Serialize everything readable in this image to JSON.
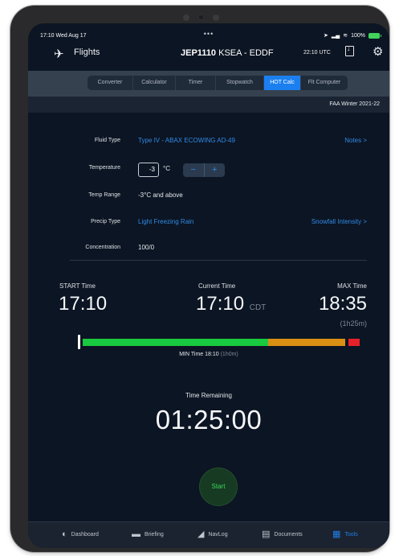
{
  "status_bar": {
    "time": "17:10",
    "date": "Wed Aug 17",
    "dots": "•••",
    "battery": "100%"
  },
  "navbar": {
    "flights_label": "Flights",
    "flight_id": "JEP1110",
    "route": "KSEA - EDDF",
    "utc_time": "22:10 UTC"
  },
  "segments": [
    {
      "label": "Converter",
      "active": false
    },
    {
      "label": "Calculator",
      "active": false
    },
    {
      "label": "Timer",
      "active": false
    },
    {
      "label": "Stopwatch",
      "active": false
    },
    {
      "label": "HOT Calc",
      "active": true
    },
    {
      "label": "Flt Computer",
      "active": false
    }
  ],
  "season": "FAA Winter 2021-22",
  "form": {
    "fluid_type": {
      "label": "Fluid Type",
      "value": "Type IV - ABAX ECOWING AD-49",
      "link": "Notes >"
    },
    "temperature": {
      "label": "Temperature",
      "value": "-3",
      "unit": "°C",
      "minus": "−",
      "plus": "+"
    },
    "temp_range": {
      "label": "Temp Range",
      "value": "-3°C and above"
    },
    "precip_type": {
      "label": "Precip Type",
      "value": "Light Freezing Rain",
      "link": "Snowfall Intensity >"
    },
    "concentration": {
      "label": "Concentration",
      "value": "100/0"
    }
  },
  "times": {
    "start_label": "START Time",
    "start_value": "17:10",
    "current_label": "Current Time",
    "current_value": "17:10",
    "current_zone": "CDT",
    "max_label": "MAX Time",
    "max_value": "18:35",
    "max_duration": "(1h25m)"
  },
  "min_time": {
    "label": "MIN Time 18:10",
    "duration": "(1h0m)"
  },
  "remaining": {
    "label": "Time Remaining",
    "value": "01:25:00"
  },
  "start_button": "Start",
  "tabs": [
    {
      "label": "Dashboard",
      "icon": "dashboard-icon",
      "active": false
    },
    {
      "label": "Briefing",
      "icon": "folder-icon",
      "active": false
    },
    {
      "label": "NavLog",
      "icon": "navlog-icon",
      "active": false
    },
    {
      "label": "Documents",
      "icon": "documents-icon",
      "active": false
    },
    {
      "label": "Tools",
      "icon": "tools-icon",
      "active": true
    }
  ],
  "colors": {
    "accent": "#1b7ff0",
    "timeline_green": "#19c93f",
    "timeline_orange": "#d98f13",
    "timeline_red": "#e6212a"
  }
}
